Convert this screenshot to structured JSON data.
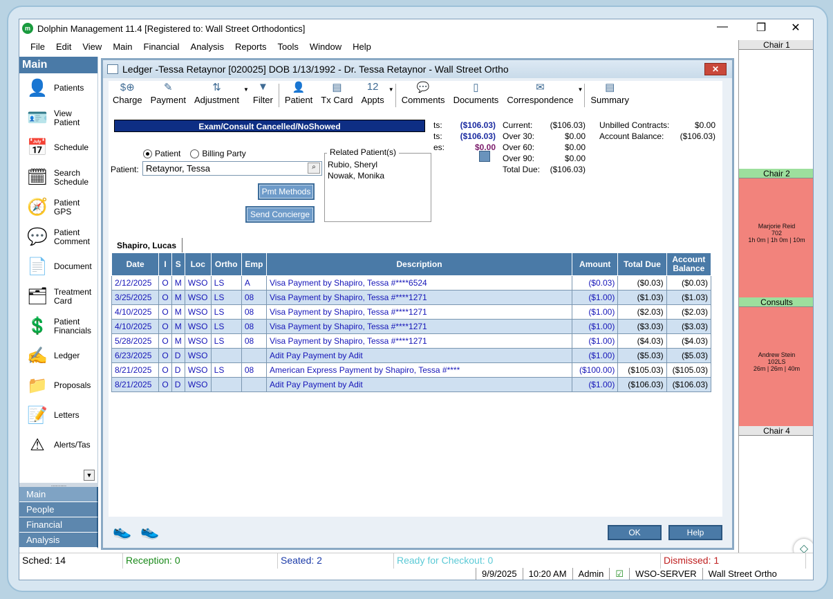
{
  "app": {
    "title": "Dolphin Management 11.4 [Registered to: Wall Street Orthodontics]",
    "logo_text": "m",
    "window_controls": {
      "minimize": "—",
      "restore": "❐",
      "close": "✕"
    },
    "menu": [
      "File",
      "Edit",
      "View",
      "Main",
      "Financial",
      "Analysis",
      "Reports",
      "Tools",
      "Window",
      "Help"
    ]
  },
  "nav": {
    "header": "Main",
    "items": [
      {
        "label": "Patients",
        "icon": "patient-icon",
        "glyph": "👤"
      },
      {
        "label": "View\nPatient",
        "icon": "view-patient-icon",
        "glyph": "🪪"
      },
      {
        "label": "Schedule",
        "icon": "calendar-clock-icon",
        "glyph": "📅"
      },
      {
        "label": "Search\nSchedule",
        "icon": "search-schedule-icon",
        "glyph": "🗓"
      },
      {
        "label": "Patient\nGPS",
        "icon": "compass-icon",
        "glyph": "🧭"
      },
      {
        "label": "Patient\nComment",
        "icon": "comment-icon",
        "glyph": "💬"
      },
      {
        "label": "Document",
        "icon": "document-icon",
        "glyph": "📄"
      },
      {
        "label": "Treatment\nCard",
        "icon": "treatment-card-icon",
        "glyph": "🗂"
      },
      {
        "label": "Patient\nFinancials",
        "icon": "money-icon",
        "glyph": "💲"
      },
      {
        "label": "Ledger",
        "icon": "ledger-icon",
        "glyph": "✍"
      },
      {
        "label": "Proposals",
        "icon": "proposal-icon",
        "glyph": "📁"
      },
      {
        "label": "Letters",
        "icon": "letter-icon",
        "glyph": "📝"
      },
      {
        "label": "Alerts/Tas",
        "icon": "alert-icon",
        "glyph": "⚠"
      }
    ],
    "grip": "..........",
    "scroll_glyph": "▼",
    "tabs": [
      "Main",
      "People",
      "Financial",
      "Analysis"
    ]
  },
  "ledger": {
    "title": "Ledger -Tessa Retaynor [020025] DOB 1/13/1992 - Dr. Tessa Retaynor - Wall Street Ortho",
    "close_label": "✕",
    "toolbar": [
      {
        "label": "Charge",
        "icon": "charge-icon",
        "glyph": "$⊕"
      },
      {
        "label": "Payment",
        "icon": "payment-icon",
        "glyph": "✎"
      },
      {
        "label": "Adjustment",
        "icon": "adjustment-icon",
        "glyph": "⇅",
        "dropdown": true
      },
      {
        "label": "Filter",
        "icon": "filter-icon",
        "glyph": "▼",
        "sep_after": true
      },
      {
        "label": "Patient",
        "icon": "patient-icon",
        "glyph": "👤"
      },
      {
        "label": "Tx Card",
        "icon": "tx-card-icon",
        "glyph": "▤"
      },
      {
        "label": "Appts",
        "icon": "appointments-icon",
        "glyph": "12",
        "dropdown": true,
        "sep_after": true
      },
      {
        "label": "Comments",
        "icon": "comments-icon",
        "glyph": "💬"
      },
      {
        "label": "Documents",
        "icon": "documents-icon",
        "glyph": "▯"
      },
      {
        "label": "Correspondence",
        "icon": "correspondence-icon",
        "glyph": "✉",
        "dropdown": true,
        "sep_after": true
      },
      {
        "label": "Summary",
        "icon": "summary-icon",
        "glyph": "▤"
      }
    ],
    "banner": "Exam/Consult Cancelled/NoShowed",
    "partial_totals": [
      {
        "label": "ts:",
        "value": "($106.03)"
      },
      {
        "label": "ts:",
        "value": "($106.03)"
      },
      {
        "label": "es:",
        "value": "$0.00"
      }
    ],
    "aging": [
      {
        "label": "Current:",
        "value": "($106.03)"
      },
      {
        "label": "Over 30:",
        "value": "$0.00"
      },
      {
        "label": "Over 60:",
        "value": "$0.00"
      },
      {
        "label": "Over 90:",
        "value": "$0.00"
      },
      {
        "label": "Total Due:",
        "value": "($106.03)"
      }
    ],
    "contracts": [
      {
        "label": "Unbilled Contracts:",
        "value": "$0.00"
      },
      {
        "label": "Account Balance:",
        "value": "($106.03)"
      }
    ],
    "radio_patient": "Patient",
    "radio_billing": "Billing Party",
    "patient_label": "Patient:",
    "patient_value": "Retaynor, Tessa",
    "pmt_methods": "Pmt Methods",
    "send_concierge": "Send Concierge",
    "related_title": "Related Patient(s)",
    "related": [
      "Rubio, Sheryl",
      "Nowak, Monika"
    ],
    "tab": "Shapiro, Lucas",
    "columns": [
      "Date",
      "I",
      "S",
      "Loc",
      "Ortho",
      "Emp",
      "Description",
      "Amount",
      "Total Due",
      "Account Balance"
    ],
    "rows": [
      [
        "2/12/2025",
        "O",
        "M",
        "WSO",
        "LS",
        "A",
        "Visa Payment by Shapiro, Tessa  #****6524",
        "($0.03)",
        "($0.03)",
        "($0.03)"
      ],
      [
        "3/25/2025",
        "O",
        "M",
        "WSO",
        "LS",
        "08",
        "Visa Payment by Shapiro, Tessa  #****1271",
        "($1.00)",
        "($1.03)",
        "($1.03)"
      ],
      [
        "4/10/2025",
        "O",
        "M",
        "WSO",
        "LS",
        "08",
        "Visa Payment by Shapiro, Tessa  #****1271",
        "($1.00)",
        "($2.03)",
        "($2.03)"
      ],
      [
        "4/10/2025",
        "O",
        "M",
        "WSO",
        "LS",
        "08",
        "Visa Payment by Shapiro, Tessa  #****1271",
        "($1.00)",
        "($3.03)",
        "($3.03)"
      ],
      [
        "5/28/2025",
        "O",
        "M",
        "WSO",
        "LS",
        "08",
        "Visa Payment by Shapiro, Tessa  #****1271",
        "($1.00)",
        "($4.03)",
        "($4.03)"
      ],
      [
        "6/23/2025",
        "O",
        "D",
        "WSO",
        "",
        "",
        "Adit Pay Payment by Adit",
        "($1.00)",
        "($5.03)",
        "($5.03)"
      ],
      [
        "8/21/2025",
        "O",
        "D",
        "WSO",
        "LS",
        "08",
        "American Express Payment by Shapiro, Tessa  #****",
        "($100.00)",
        "($105.03)",
        "($105.03)"
      ],
      [
        "8/21/2025",
        "O",
        "D",
        "WSO",
        "",
        "",
        "Adit Pay Payment by Adit",
        "($1.00)",
        "($106.03)",
        "($106.03)"
      ]
    ],
    "ok_label": "OK",
    "help_label": "Help"
  },
  "chairs": {
    "chair1": "Chair 1",
    "chair2": "Chair 2",
    "appt1": {
      "name": "Marjorie Reid",
      "code": "702",
      "time": "1h 0m | 1h 0m | 10m"
    },
    "consults": "Consults",
    "appt2": {
      "name": "Andrew Stein",
      "code": "102LS",
      "time": "26m | 26m | 40m"
    },
    "chair4": "Chair 4"
  },
  "status": {
    "sched": "Sched: 14",
    "reception": "Reception: 0",
    "seated": "Seated: 2",
    "ready": "Ready for Checkout: 0",
    "dismissed": "Dismissed: 1",
    "colors": {
      "reception": "#1a8a1a",
      "seated": "#1a3aa8",
      "ready": "#5ccad6",
      "dismissed": "#c02020"
    }
  },
  "bottom": {
    "date": "9/9/2025",
    "time": "10:20 AM",
    "user": "Admin",
    "server": "WSO-SERVER",
    "office": "Wall Street Ortho"
  }
}
